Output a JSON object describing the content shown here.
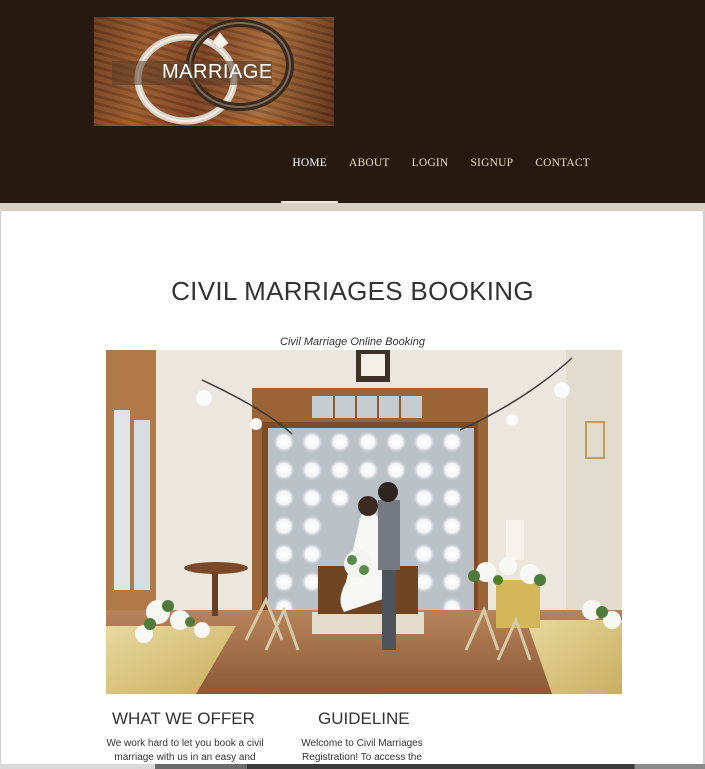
{
  "logo": {
    "text": "MARRIAGE"
  },
  "nav": {
    "items": [
      {
        "label": "HOME"
      },
      {
        "label": "ABOUT"
      },
      {
        "label": "LOGIN"
      },
      {
        "label": "SIGNUP"
      },
      {
        "label": "CONTACT"
      }
    ],
    "active": "HOME"
  },
  "main": {
    "title": "CIVIL MARRIAGES BOOKING",
    "caption": "Civil Marriage Online Booking",
    "photo_icon": "wedding-couple-photo"
  },
  "sections": [
    {
      "title": "WHAT WE OFFER",
      "body_lines": [
        "We work hard to let you book a civil",
        "marriage with us in an easy and"
      ]
    },
    {
      "title": "GUIDELINE",
      "body_lines": [
        "Welcome to Civil Marriages",
        "Registration! To access the"
      ]
    }
  ],
  "colors": {
    "header_bg": "#261a10",
    "nav_text": "#e8dcc4",
    "title_text": "#333333"
  }
}
